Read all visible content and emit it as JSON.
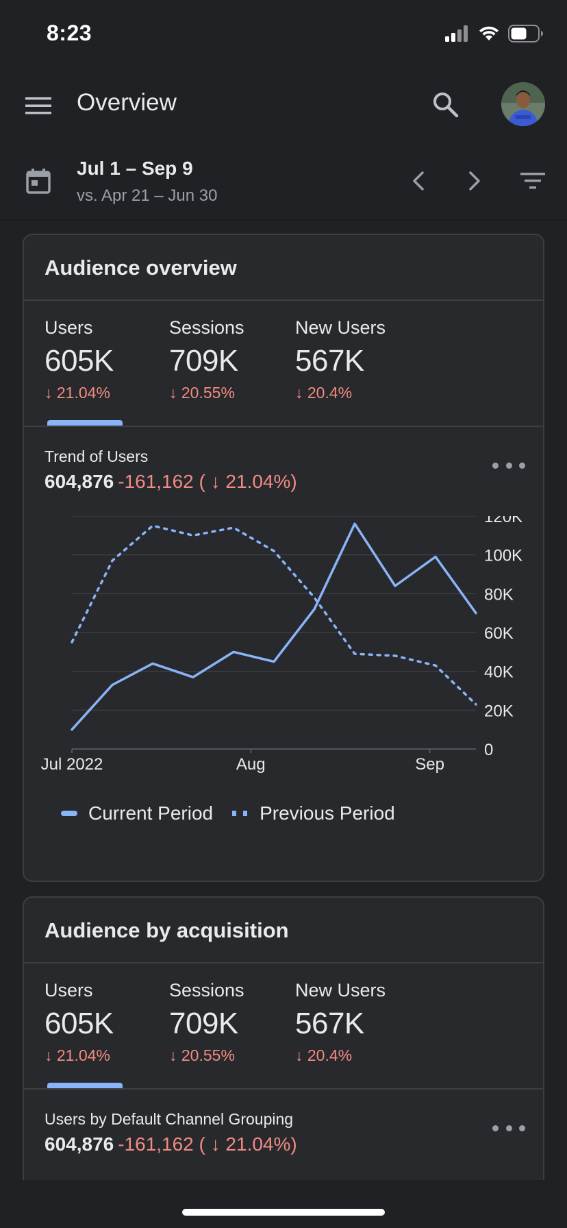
{
  "status": {
    "time": "8:23"
  },
  "app_bar": {
    "title": "Overview"
  },
  "date_range": {
    "current": "Jul 1 – Sep 9",
    "compare": "vs. Apr 21 – Jun 30"
  },
  "audience_overview": {
    "title": "Audience overview",
    "metrics": [
      {
        "label": "Users",
        "value": "605K",
        "change": "↓ 21.04%"
      },
      {
        "label": "Sessions",
        "value": "709K",
        "change": "↓ 20.55%"
      },
      {
        "label": "New Users",
        "value": "567K",
        "change": "↓ 20.4%"
      }
    ],
    "trend": {
      "label": "Trend of Users",
      "total": "604,876",
      "delta": "-161,162 ( ↓ 21.04%)"
    }
  },
  "chart_data": {
    "type": "line",
    "x": [
      "Jul 1",
      "Jul 8",
      "Jul 15",
      "Jul 22",
      "Jul 29",
      "Aug 5",
      "Aug 12",
      "Aug 19",
      "Aug 26",
      "Sep 2",
      "Sep 9"
    ],
    "series": [
      {
        "name": "Current Period",
        "style": "solid",
        "values": [
          10000,
          33000,
          44000,
          37000,
          50000,
          45000,
          72000,
          116000,
          84000,
          99000,
          70000
        ]
      },
      {
        "name": "Previous Period",
        "style": "dotted",
        "values": [
          55000,
          97000,
          115000,
          110000,
          114000,
          102000,
          78000,
          49000,
          48000,
          43000,
          23000
        ]
      }
    ],
    "x_tick_labels": [
      {
        "label": "Jul 2022",
        "at": "Jul 1"
      },
      {
        "label": "Aug",
        "at": "Aug 1"
      },
      {
        "label": "Sep",
        "at": "Sep 1"
      }
    ],
    "y_ticks": [
      0,
      20000,
      40000,
      60000,
      80000,
      100000,
      120000
    ],
    "y_tick_labels": [
      "0",
      "20K",
      "40K",
      "60K",
      "80K",
      "100K",
      "120K"
    ],
    "ylim": [
      0,
      120000
    ],
    "y_axis_side": "right",
    "grid": true,
    "legend_position": "bottom",
    "color": "#8ab4f8"
  },
  "audience_acquisition": {
    "title": "Audience by acquisition",
    "metrics": [
      {
        "label": "Users",
        "value": "605K",
        "change": "↓ 21.04%"
      },
      {
        "label": "Sessions",
        "value": "709K",
        "change": "↓ 20.55%"
      },
      {
        "label": "New Users",
        "value": "567K",
        "change": "↓ 20.4%"
      }
    ],
    "trend": {
      "label": "Users by Default Channel Grouping",
      "total": "604,876",
      "delta": "-161,162 ( ↓ 21.04%)"
    }
  },
  "icons": {
    "menu": "menu-icon",
    "search": "search-icon",
    "calendar": "calendar-icon",
    "prev": "chevron-left-icon",
    "next": "chevron-right-icon",
    "filter": "filter-icon",
    "more": "more-horizontal-icon"
  },
  "colors": {
    "background": "#202124",
    "card": "#28292d",
    "accent": "#8ab4f8",
    "negative": "#f28b82"
  }
}
